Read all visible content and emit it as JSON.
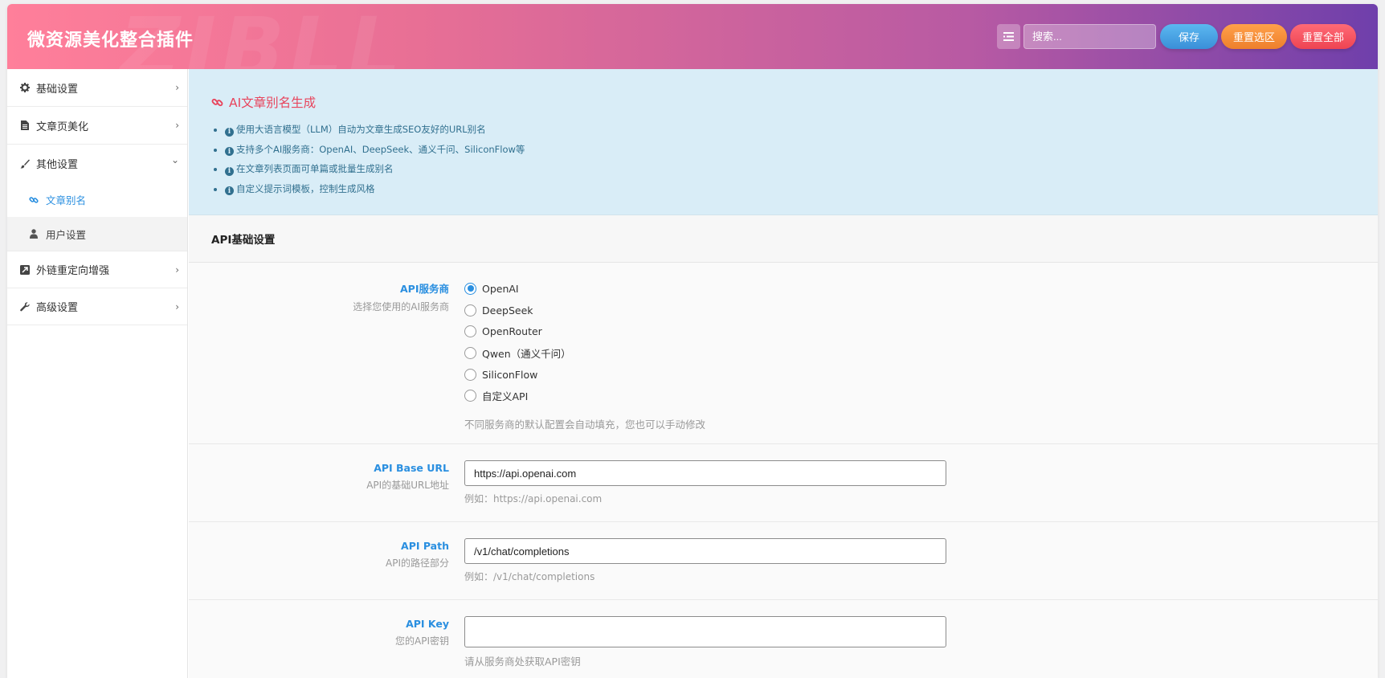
{
  "header": {
    "title": "微资源美化整合插件",
    "watermark": "ZIBLL",
    "search_placeholder": "搜索...",
    "buttons": {
      "save": "保存",
      "reset_selection": "重置选区",
      "reset_all": "重置全部"
    }
  },
  "sidebar": {
    "items": [
      {
        "label": "基础设置",
        "icon": "gear-icon",
        "chevron": "›"
      },
      {
        "label": "文章页美化",
        "icon": "document-icon",
        "chevron": "›"
      },
      {
        "label": "其他设置",
        "icon": "brush-icon",
        "chevron": "⌄"
      },
      {
        "label": "外链重定向增强",
        "icon": "external-link-icon",
        "chevron": "›"
      },
      {
        "label": "高级设置",
        "icon": "wrench-icon",
        "chevron": "›"
      }
    ],
    "subitems": [
      {
        "label": "文章别名",
        "icon": "link-icon",
        "active": true
      },
      {
        "label": "用户设置",
        "icon": "user-icon",
        "active": false
      }
    ]
  },
  "notice": {
    "title": "AI文章别名生成",
    "items": [
      "使用大语言模型（LLM）自动为文章生成SEO友好的URL别名",
      "支持多个AI服务商：OpenAI、DeepSeek、通义千问、SiliconFlow等",
      "在文章列表页面可单篇或批量生成别名",
      "自定义提示词模板，控制生成风格"
    ]
  },
  "section": {
    "title": "API基础设置"
  },
  "fields": {
    "provider": {
      "label": "API服务商",
      "desc": "选择您使用的AI服务商",
      "options": [
        "OpenAI",
        "DeepSeek",
        "OpenRouter",
        "Qwen（通义千问）",
        "SiliconFlow",
        "自定义API"
      ],
      "selected": "OpenAI",
      "hint": "不同服务商的默认配置会自动填充，您也可以手动修改"
    },
    "base_url": {
      "label": "API Base URL",
      "desc": "API的基础URL地址",
      "value": "https://api.openai.com",
      "hint": "例如：https://api.openai.com"
    },
    "path": {
      "label": "API Path",
      "desc": "API的路径部分",
      "value": "/v1/chat/completions",
      "hint": "例如：/v1/chat/completions"
    },
    "key": {
      "label": "API Key",
      "desc": "您的API密钥",
      "value": "",
      "hint": "请从服务商处获取API密钥"
    }
  },
  "colors": {
    "accent": "#2a8fe0",
    "notice_bg": "#d9edf7",
    "notice_title": "#e8445c"
  }
}
